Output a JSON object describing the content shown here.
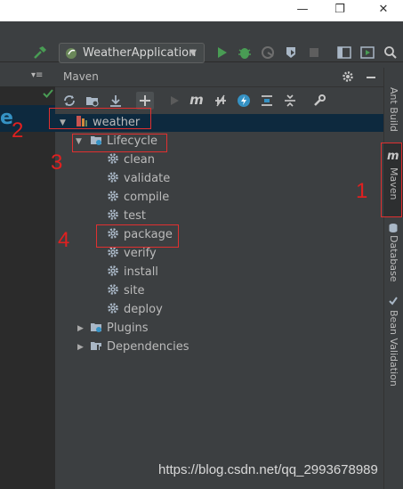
{
  "window_controls": {
    "minimize": "—",
    "restore": "❐",
    "close": "✕"
  },
  "toolbar": {
    "run_config": {
      "label": "WeatherApplication",
      "arrow": "▼"
    },
    "icons": [
      "hammer-icon",
      "run-icon",
      "debug-icon",
      "coverage-icon",
      "profile-icon",
      "stop-icon",
      "frame-icon",
      "run-dashboard-icon",
      "search-icon"
    ]
  },
  "left": {
    "tab_glyph": "▾≡",
    "file_letter": "e"
  },
  "maven": {
    "title": "Maven",
    "tree": {
      "root": "weather",
      "lifecycle": {
        "label": "Lifecycle",
        "goals": [
          "clean",
          "validate",
          "compile",
          "test",
          "package",
          "verify",
          "install",
          "site",
          "deploy"
        ]
      },
      "plugins": "Plugins",
      "dependencies": "Dependencies"
    }
  },
  "right_tabs": {
    "ant": "Ant Build",
    "maven": "Maven",
    "database": "Database",
    "bean": "Bean Validation"
  },
  "annotations": {
    "n1": "1",
    "n2": "2",
    "n3": "3",
    "n4": "4"
  },
  "watermark": "https://blog.csdn.net/qq_2993678989",
  "colors": {
    "accent_red": "#e03030",
    "selection": "#0d293e",
    "run_green": "#499c54",
    "panel_bg": "#3c3f41"
  }
}
